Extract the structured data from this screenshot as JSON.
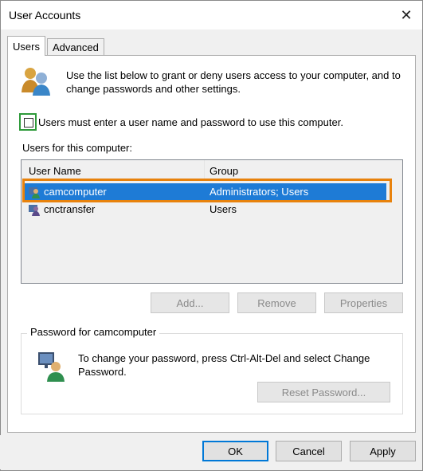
{
  "window": {
    "title": "User Accounts",
    "close_glyph": "✕"
  },
  "tabs": [
    {
      "label": "Users",
      "active": true
    },
    {
      "label": "Advanced",
      "active": false
    }
  ],
  "intro": {
    "text": "Use the list below to grant or deny users access to your computer, and to change passwords and other settings.",
    "icon": "users-icon"
  },
  "require_login": {
    "label": "Users must enter a user name and password to use this computer.",
    "checked": false
  },
  "users_section": {
    "label": "Users for this computer:"
  },
  "users_table": {
    "columns": [
      "User Name",
      "Group"
    ],
    "rows": [
      {
        "name": "camcomputer",
        "group": "Administrators; Users",
        "selected": true
      },
      {
        "name": "cnctransfer",
        "group": "Users",
        "selected": false
      }
    ]
  },
  "user_buttons": {
    "add": "Add...",
    "remove": "Remove",
    "properties": "Properties"
  },
  "password_group": {
    "legend": "Password for camcomputer",
    "text": "To change your password, press Ctrl-Alt-Del and select Change Password.",
    "reset_button": "Reset Password..."
  },
  "dialog_buttons": {
    "ok": "OK",
    "cancel": "Cancel",
    "apply": "Apply"
  },
  "colors": {
    "selection": "#1e7bd6",
    "highlight_box": "#e8820c",
    "checkbox_highlight": "#2e9a3a"
  }
}
